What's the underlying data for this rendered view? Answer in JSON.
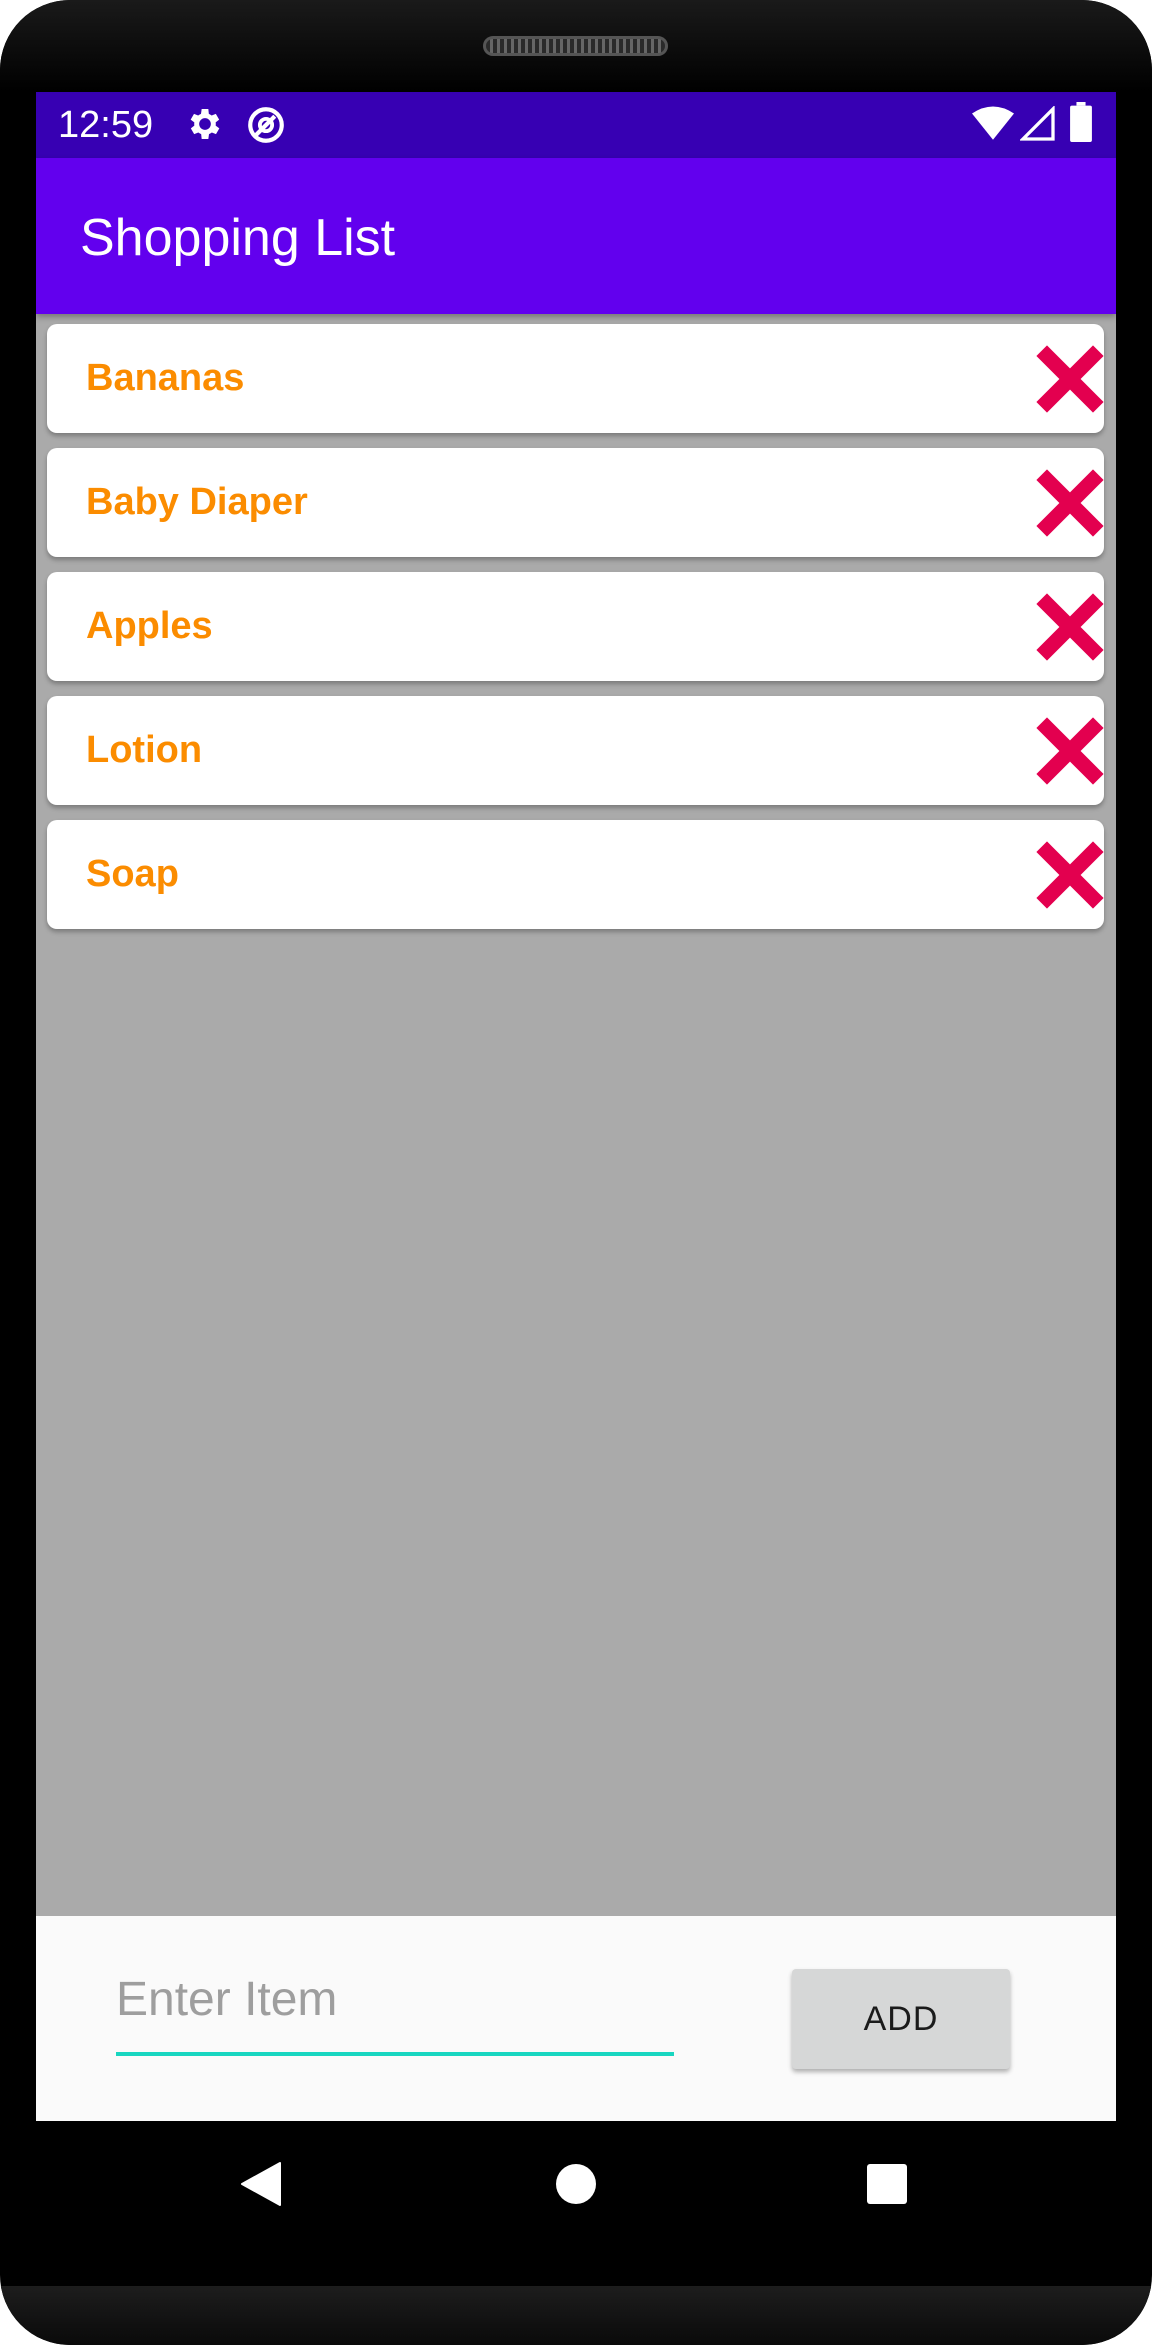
{
  "status_bar": {
    "time": "12:59",
    "icons": [
      "gear-icon",
      "at-sign-icon",
      "wifi-icon",
      "cell-signal-icon",
      "battery-icon"
    ]
  },
  "app_bar": {
    "title": "Shopping List"
  },
  "shopping_list": {
    "items": [
      {
        "label": "Bananas",
        "delete_icon": "close-icon"
      },
      {
        "label": "Baby Diaper",
        "delete_icon": "close-icon"
      },
      {
        "label": "Apples",
        "delete_icon": "close-icon"
      },
      {
        "label": "Lotion",
        "delete_icon": "close-icon"
      },
      {
        "label": "Soap",
        "delete_icon": "close-icon"
      }
    ]
  },
  "input_panel": {
    "placeholder": "Enter Item",
    "value": "",
    "add_label": "ADD"
  },
  "nav_bar": {
    "buttons": [
      "back-icon",
      "home-icon",
      "recents-icon"
    ]
  },
  "colors": {
    "status_bar": "#3700b3",
    "app_bar": "#6200ee",
    "item_text": "#fb8c00",
    "delete_icon": "#e3004f",
    "list_background": "#aaaaaa",
    "input_underline": "#18d6c0",
    "add_button": "#d6d7d7"
  }
}
